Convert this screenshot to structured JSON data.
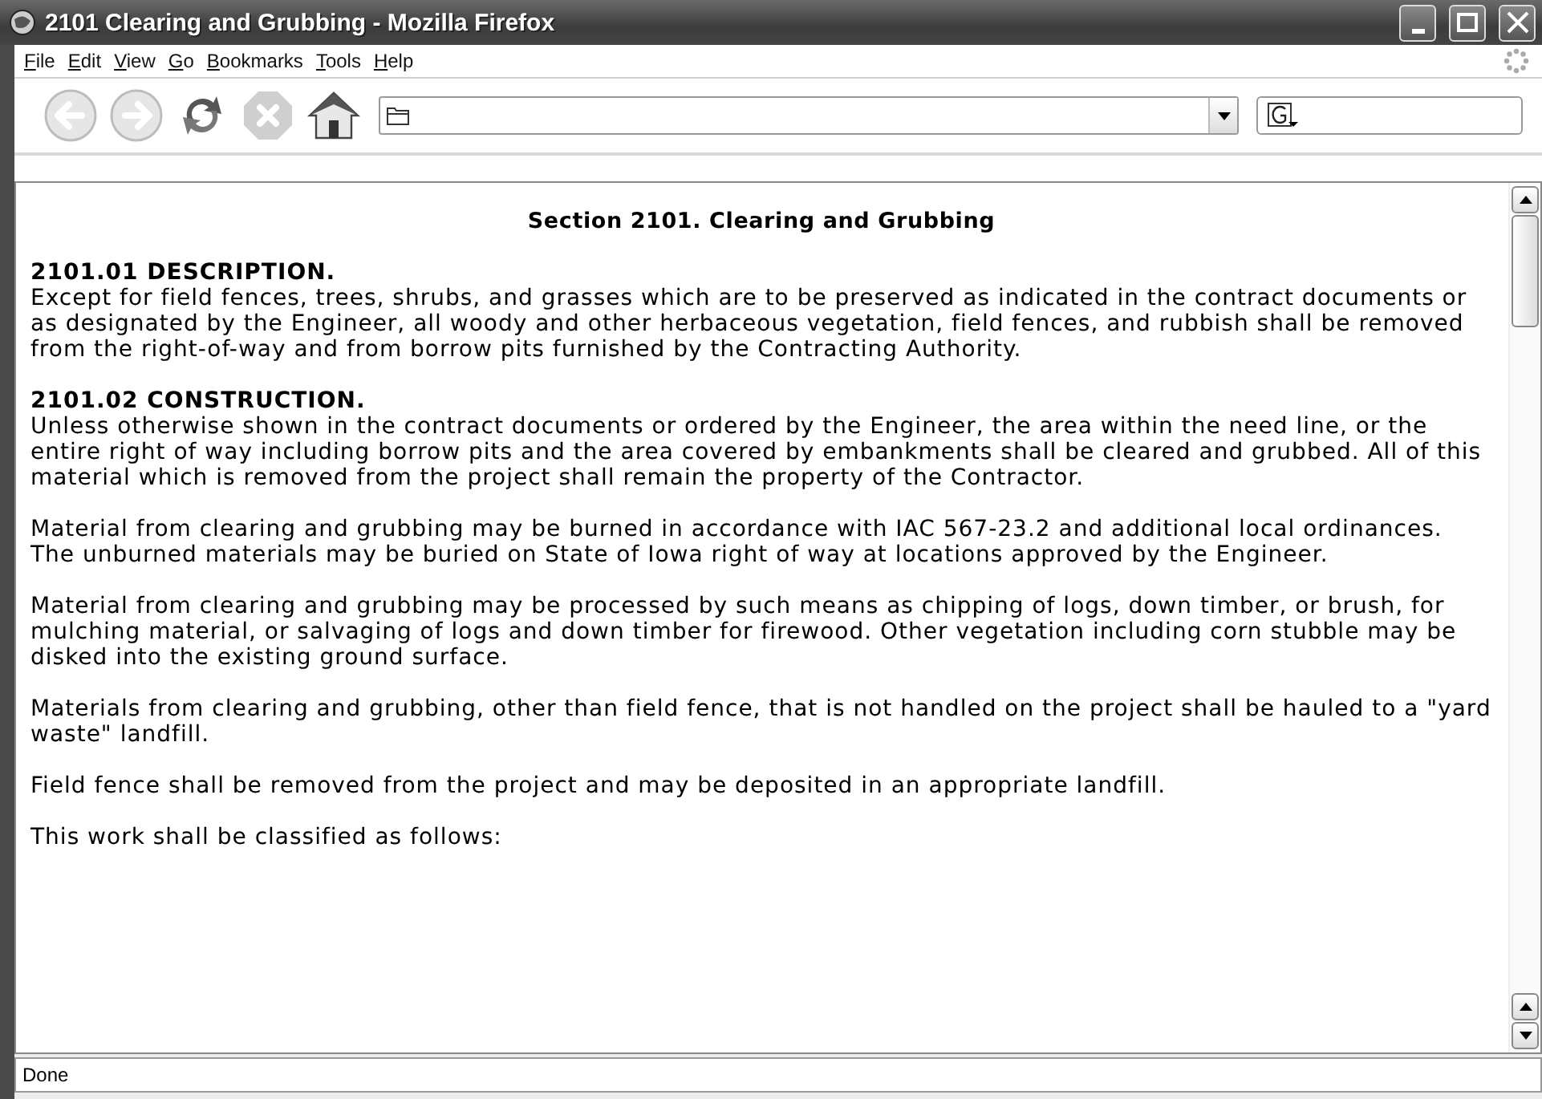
{
  "window": {
    "title": "2101 Clearing and Grubbing - Mozilla Firefox"
  },
  "menu": [
    "File",
    "Edit",
    "View",
    "Go",
    "Bookmarks",
    "Tools",
    "Help"
  ],
  "toolbar": [
    {
      "kind": "back",
      "disabled": true
    },
    {
      "kind": "forward",
      "disabled": true
    },
    {
      "kind": "reload",
      "disabled": false
    },
    {
      "kind": "stop",
      "disabled": true
    },
    {
      "kind": "home",
      "disabled": false
    }
  ],
  "document": {
    "title": "Section 2101. Clearing and Grubbing",
    "sections": [
      {
        "heading": "2101.01 DESCRIPTION.",
        "paragraphs": [
          "Except for field fences, trees, shrubs, and grasses which are to be preserved as indicated in the contract documents or as designated by the Engineer, all woody and other herbaceous vegetation, field fences, and rubbish shall be removed from the right-of-way and from borrow pits furnished by the Contracting Authority."
        ]
      },
      {
        "heading": "2101.02 CONSTRUCTION.",
        "paragraphs": [
          "Unless otherwise shown in the contract documents or ordered by the Engineer, the area within the need line, or the entire right of way including borrow pits and the area covered by embankments shall be cleared and grubbed. All of this material which is removed from the project shall remain the property of the Contractor.",
          "Material from clearing and grubbing may be burned in accordance with IAC 567-23.2 and additional local ordinances. The unburned materials may be buried on State of Iowa right of way at locations approved by the Engineer.",
          "Material from clearing and grubbing may be processed by such means as chipping of logs, down timber, or brush, for mulching material, or salvaging of logs and down timber for firewood. Other vegetation including corn stubble may be disked into the existing ground surface.",
          "Materials from clearing and grubbing, other than field fence, that is not handled on the project shall be hauled to a \"yard waste\" landfill.",
          "Field fence shall be removed from the project and may be deposited in an appropriate landfill.",
          "This work shall be classified as follows:"
        ]
      }
    ]
  },
  "status_bar": "Done"
}
